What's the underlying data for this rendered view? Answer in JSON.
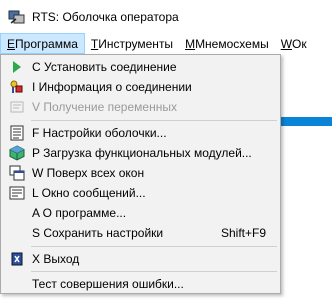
{
  "window": {
    "title": "RTS: Оболочка оператора",
    "icon": "rts-app-icon"
  },
  "menubar": [
    {
      "key": "Е",
      "label": " Программа"
    },
    {
      "key": "Т",
      "label": " Инструменты"
    },
    {
      "key": "М",
      "label": " Мнемосхемы"
    },
    {
      "key": "W",
      "label": " Ок"
    }
  ],
  "menu": {
    "items": [
      {
        "label": "С Установить соединение",
        "icon": "connect-icon",
        "enabled": true
      },
      {
        "label": "I Информация о соединении",
        "icon": "connection-info-icon",
        "enabled": true
      },
      {
        "label": "V Получение переменных",
        "icon": "variables-icon",
        "enabled": false
      },
      {
        "label": "F Настройки оболочки...",
        "icon": "settings-list-icon",
        "enabled": true
      },
      {
        "label": "P Загрузка функциональных модулей...",
        "icon": "modules-cube-icon",
        "enabled": true
      },
      {
        "label": "W Поверх всех окон",
        "icon": "windows-on-top-icon",
        "enabled": true
      },
      {
        "label": "L Окно сообщений...",
        "icon": "messages-window-icon",
        "enabled": true
      },
      {
        "label": "A О программе...",
        "icon": "",
        "enabled": true
      },
      {
        "label": "S Сохранить настройки",
        "shortcut": "Shift+F9",
        "icon": "",
        "enabled": true
      },
      {
        "label": "X Выход",
        "icon": "exit-icon",
        "enabled": true
      },
      {
        "label": "Тест совершения ошибки...",
        "icon": "",
        "enabled": true
      }
    ]
  },
  "colors": {
    "menu_bg": "#f2f2f2",
    "active_menu": "#cce8ff",
    "selection": "#0a84d6",
    "disabled_text": "#9a9a9a"
  }
}
